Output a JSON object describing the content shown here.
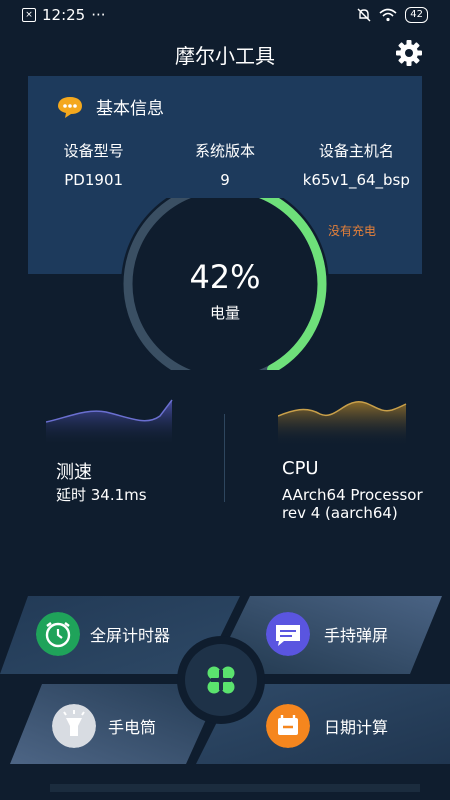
{
  "status": {
    "time": "12:25",
    "dots": "···",
    "battery": "42"
  },
  "app": {
    "title": "摩尔小工具"
  },
  "info": {
    "title": "基本信息",
    "columns": [
      {
        "label": "设备型号",
        "value": "PD1901"
      },
      {
        "label": "系统版本",
        "value": "9"
      },
      {
        "label": "设备主机名",
        "value": "k65v1_64_bsp"
      }
    ],
    "charging_status": "没有充电"
  },
  "battery": {
    "percent_text": "42%",
    "percent": 42,
    "label": "电量"
  },
  "speed": {
    "title": "测速",
    "latency": "延时 34.1ms"
  },
  "cpu": {
    "title": "CPU",
    "desc_line1": "AArch64 Processor",
    "desc_line2": "rev 4 (aarch64)"
  },
  "tools": {
    "fullscreen_timer": "全屏计时器",
    "handheld_marquee": "手持弹屏",
    "flashlight": "手电筒",
    "date_calc": "日期计算"
  },
  "colors": {
    "accent_green": "#6ee07a",
    "card_blue": "#1d3a5c",
    "charge_orange": "#e4803a"
  }
}
